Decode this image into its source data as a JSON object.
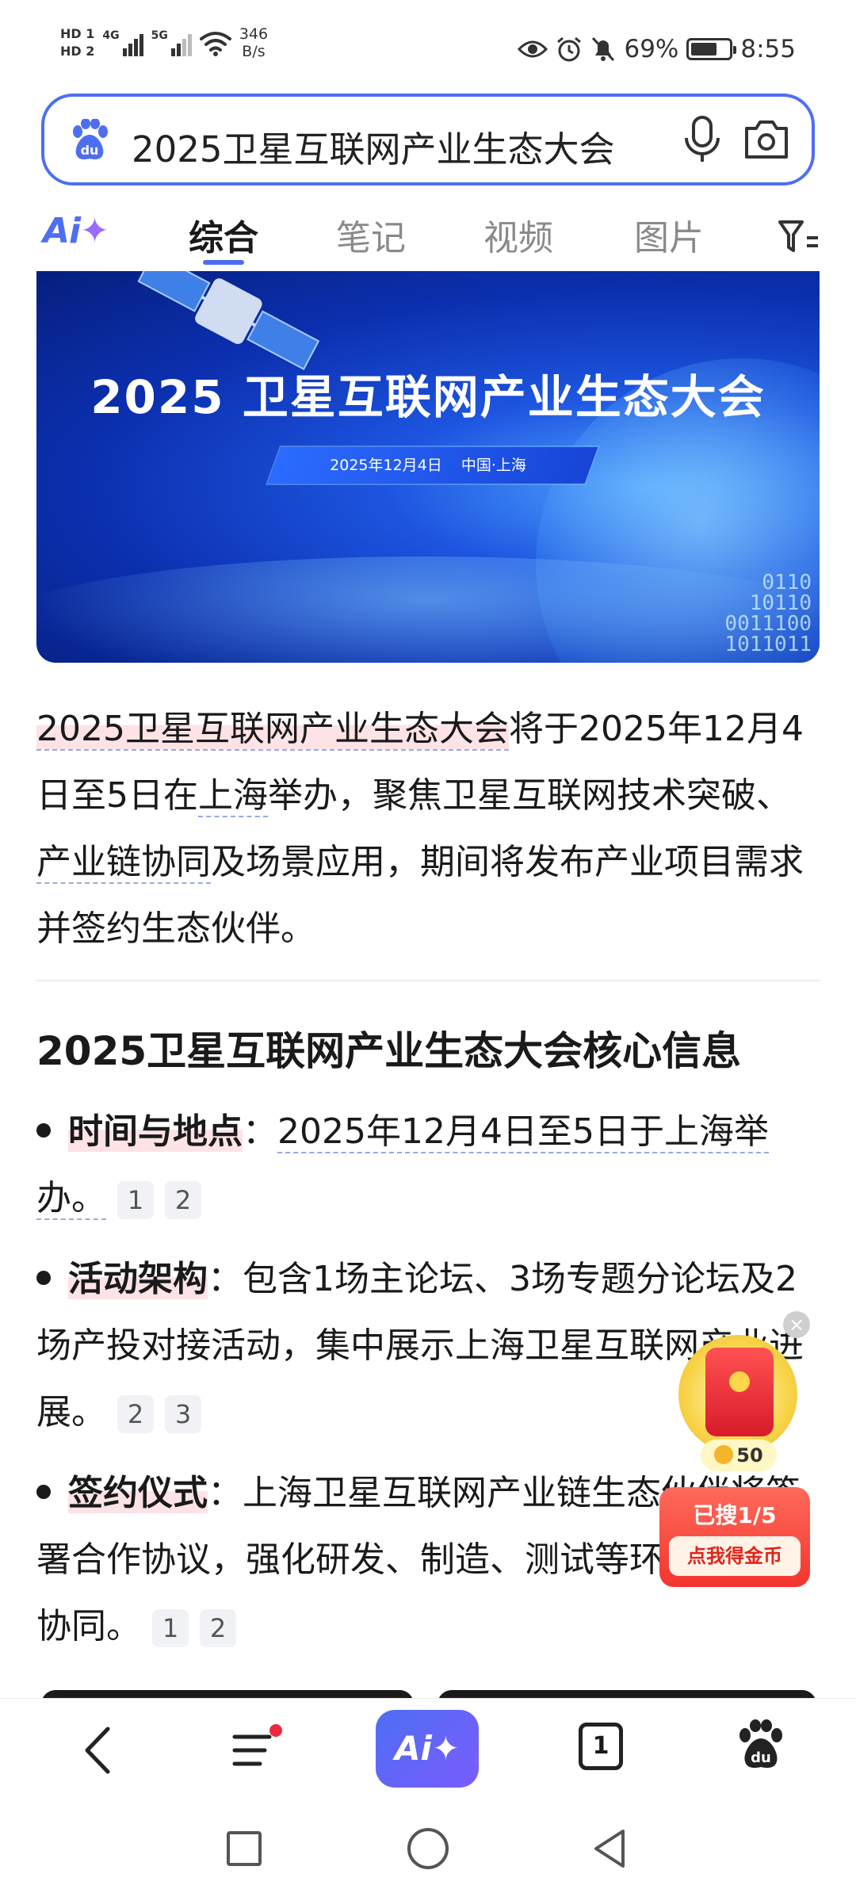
{
  "status_bar": {
    "hd1": "HD 1",
    "hd2": "HD 2",
    "net1": "4G",
    "net2": "5G",
    "speed_value": "346",
    "speed_unit": "B/s",
    "battery": "69%",
    "battery_level": 0.69,
    "time": "8:55",
    "icons": [
      "eye-icon",
      "alarm-icon",
      "mute-bell-icon",
      "battery-icon"
    ]
  },
  "search": {
    "query": "2025卫星互联网产业生态大会",
    "icons": [
      "baidu-paw-icon",
      "microphone-icon",
      "camera-icon"
    ]
  },
  "tabs": {
    "ai_label": "Ai",
    "items": [
      "综合",
      "笔记",
      "视频",
      "图片"
    ],
    "active_index": 0
  },
  "banner": {
    "title": "2025 卫星互联网产业生态大会",
    "date": "2025年12月4日",
    "location": "中国·上海",
    "binary_lines": [
      "0110",
      "10110",
      "0011100",
      "1011011"
    ]
  },
  "summary": {
    "title_link": "2025卫星互联网产业生态大会",
    "part1": "将于2025年12月4日至5日在",
    "link_shanghai": "上海",
    "part2": "举办，聚焦卫星互联网技术突破、",
    "link_chain": "产业链协同",
    "part3": "及场景应用，期间将发布产业项目需求并签约生态伙伴。"
  },
  "section": {
    "title": "2025卫星互联网产业生态大会核心信息",
    "bullets": [
      {
        "label": "时间与地点",
        "sep": "：",
        "text": "2025年12月4日至5日于上海举办。",
        "cites": [
          "1",
          "2"
        ]
      },
      {
        "label": "活动架构",
        "sep": "：",
        "text": "包含1场主论坛、3场专题分论坛及2场产投对接活动，集中展示上海卫星互联网产业进展。",
        "cites": [
          "2",
          "3"
        ]
      },
      {
        "label": "签约仪式",
        "sep": "：",
        "text": "上海卫星互联网产业链生态伙伴将签署合作协议，强化研发、制造、测试等环节的跨链协同。",
        "cites": [
          "1",
          "2"
        ]
      }
    ]
  },
  "reward": {
    "coins": "50",
    "progress": "已搜1/5",
    "button": "点我得金币"
  },
  "bottom_bar": {
    "ai_label": "Ai✦",
    "tab_count": "1",
    "icons": [
      "back-icon",
      "menu-icon",
      "ai-assistant-icon",
      "tab-count-icon",
      "baidu-home-icon"
    ]
  },
  "colors": {
    "accent": "#4e6ef2",
    "highlight": "#fde3e6",
    "reward_red": "#f2352e"
  }
}
